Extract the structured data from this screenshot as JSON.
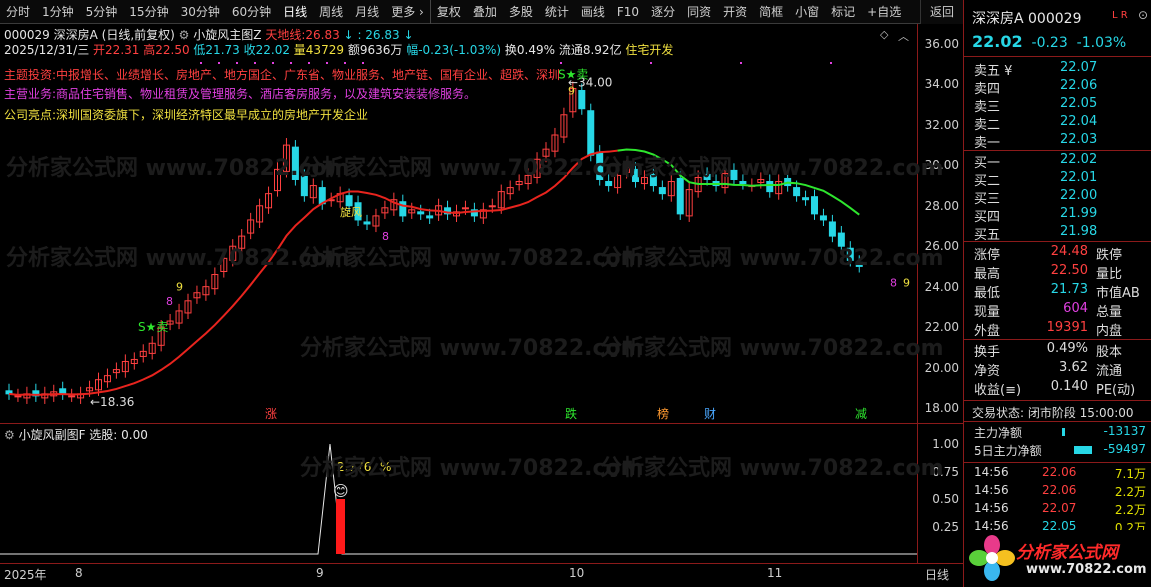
{
  "toolbar": {
    "items": [
      "分时",
      "1分钟",
      "5分钟",
      "15分钟",
      "30分钟",
      "60分钟",
      "日线",
      "周线",
      "月线",
      "更多",
      "复权",
      "叠加",
      "多股",
      "统计",
      "画线",
      "F10",
      "逐分",
      "同资",
      "开资",
      "简框",
      "小窗",
      "标记",
      "+自选"
    ],
    "active": "日线",
    "back_label": "返回"
  },
  "header": {
    "stock_line": "000029 深深房A (日线,前复权)",
    "indicator_name": "小旋风主图Z",
    "sky_line_label": "天地线:",
    "sky_line_value": "26.83",
    "sky_line_value2": ": 26.83",
    "date": "2025/12/31/三",
    "open": "开22.31",
    "high": "高22.50",
    "low": "低21.73",
    "close": "收22.02",
    "volume": "量43729",
    "amount": "额9636万",
    "change": "幅-0.23(-1.03%)",
    "turnover": "换0.49%",
    "float_cap": "流通8.92亿",
    "sector": "住宅开发"
  },
  "notes": {
    "theme": "主题投资:中报增长、业绩增长、房地产、地方国企、广东省、物业服务、地产链、国有企业、超跌、深圳",
    "business": "主营业务:商品住宅销售、物业租赁及管理服务、酒店客房服务，以及建筑安装装修服务。",
    "highlight": "公司亮点:深圳国资委旗下，深圳经济特区最早成立的房地产开发企业"
  },
  "price_axis_ticks": [
    "36.00",
    "34.00",
    "32.00",
    "30.00",
    "28.00",
    "26.00",
    "24.00",
    "22.00",
    "20.00",
    "18.00"
  ],
  "markers": {
    "high_label": "34.00",
    "low_label": "18.36",
    "buy_label": "S★卖",
    "sell_label": "S★卖",
    "event_zhang": "涨",
    "event_die": "跌",
    "event_bang": "榜",
    "event_cai": "财",
    "event_jian": "减",
    "count_9": "9",
    "count_8": "8",
    "cross_label": "旋风"
  },
  "sub_chart": {
    "title": "小旋风副图F 选股: 0.00",
    "value_label": "2.776",
    "percent_label": "%",
    "ticks": [
      "1.00",
      "0.75",
      "0.50",
      "0.25"
    ]
  },
  "date_axis": {
    "labels": [
      "2025年",
      "8",
      "9",
      "10",
      "11"
    ],
    "corner": "日线"
  },
  "panel": {
    "title": "深深房A 000029",
    "badge": "L R",
    "price": "22.02",
    "change": "-0.23",
    "change_pct": "-1.03%",
    "asks": [
      {
        "label": "卖五 ¥",
        "price": "22.07"
      },
      {
        "label": "卖四",
        "price": "22.06"
      },
      {
        "label": "卖三",
        "price": "22.05"
      },
      {
        "label": "卖二",
        "price": "22.04"
      },
      {
        "label": "卖一",
        "price": "22.03"
      }
    ],
    "bids": [
      {
        "label": "买一",
        "price": "22.02"
      },
      {
        "label": "买二",
        "price": "22.01"
      },
      {
        "label": "买三",
        "price": "22.00"
      },
      {
        "label": "买四",
        "price": "21.99"
      },
      {
        "label": "买五",
        "price": "21.98"
      }
    ],
    "stats": [
      {
        "l1": "涨停",
        "v1": "24.48",
        "c1": "#ff4040",
        "l2": "跌停"
      },
      {
        "l1": "最高",
        "v1": "22.50",
        "c1": "#ff4040",
        "l2": "量比"
      },
      {
        "l1": "最低",
        "v1": "21.73",
        "c1": "#27d7e6",
        "l2": "市值AB"
      },
      {
        "l1": "现量",
        "v1": "604",
        "c1": "#e040e0",
        "l2": "总量"
      },
      {
        "l1": "外盘",
        "v1": "19391",
        "c1": "#ff4040",
        "l2": "内盘"
      }
    ],
    "stats2": [
      {
        "l1": "换手",
        "v1": "0.49%",
        "l2": "股本"
      },
      {
        "l1": "净资",
        "v1": "3.62",
        "l2": "流通"
      },
      {
        "l1": "收益(≡)",
        "v1": "0.140",
        "l2": "PE(动)"
      }
    ],
    "status_label": "交易状态: 闭市阶段 15:00:00",
    "flows": [
      {
        "label": "主力净额",
        "value": "-13137"
      },
      {
        "label": "5日主力净额",
        "value": "-59497"
      }
    ],
    "ticks": [
      {
        "time": "14:56",
        "price": "22.06",
        "vol": "7.1万"
      },
      {
        "time": "14:56",
        "price": "22.06",
        "vol": "2.2万"
      },
      {
        "time": "14:56",
        "price": "22.07",
        "vol": "2.2万"
      },
      {
        "time": "14:56",
        "price": "22.05",
        "vol": "0.2万"
      }
    ],
    "logo_text": "分析家公式网",
    "logo_url": "www.70822.com"
  },
  "watermark": "分析家公式网 www.70822.com",
  "colors": {
    "up": "#ff4040",
    "down": "#27d7e6",
    "ma_red": "#e8241e",
    "ma_green": "#2ee62e",
    "bg": "#000000"
  }
}
